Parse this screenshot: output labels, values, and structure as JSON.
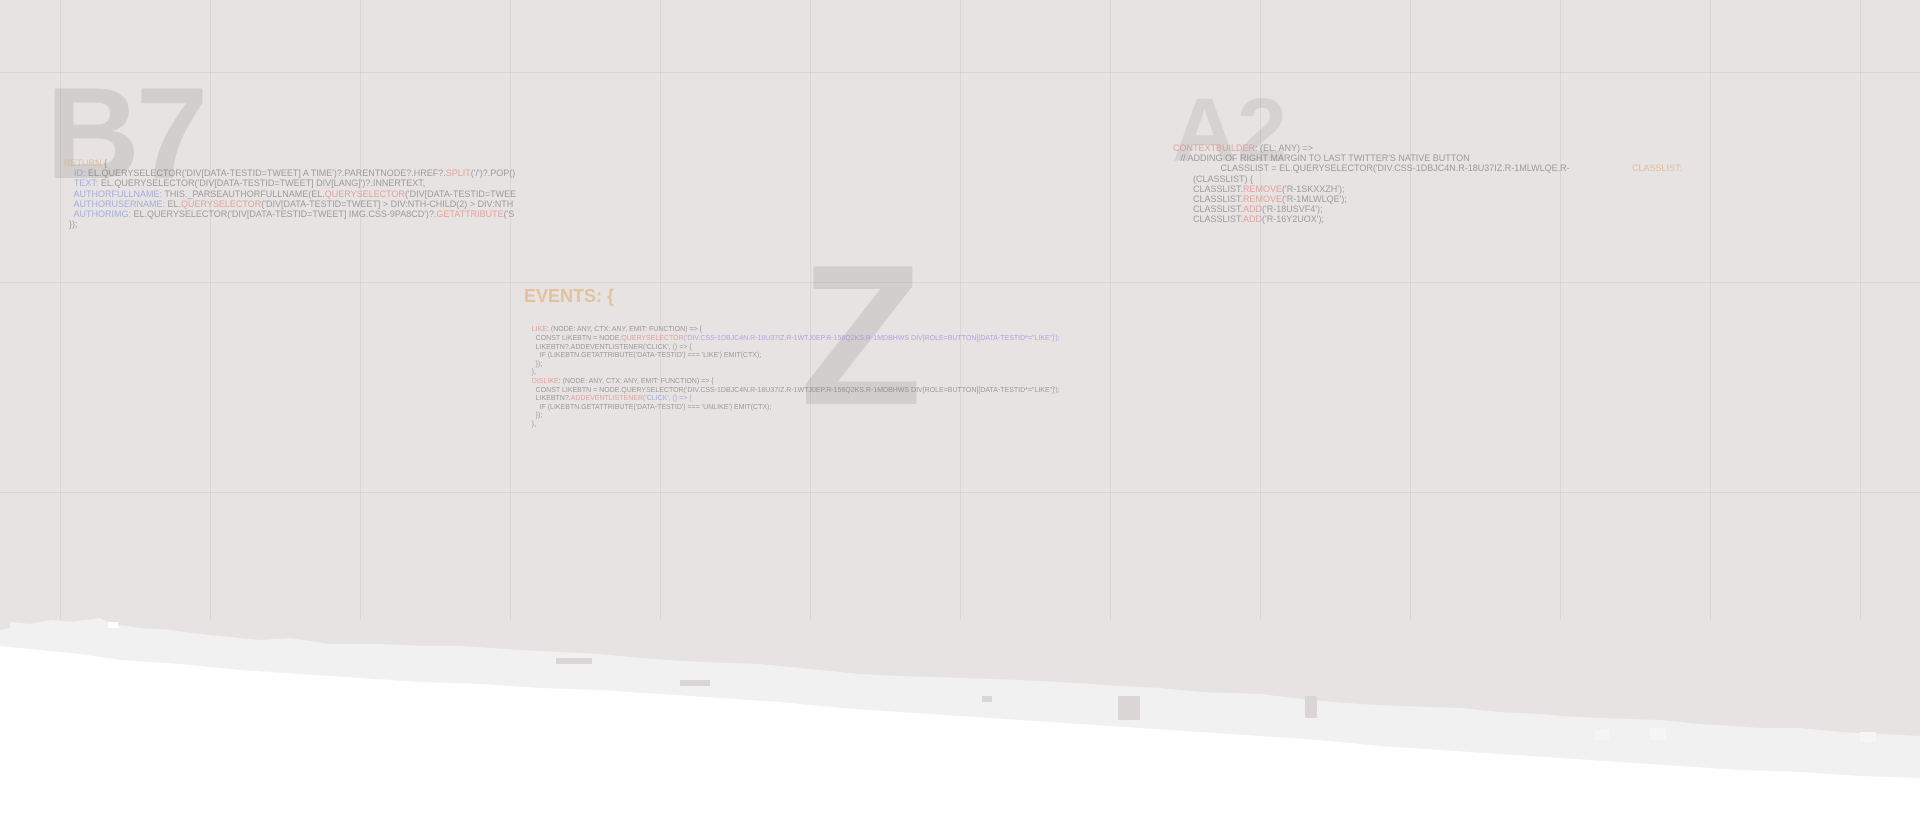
{
  "background": {
    "color": "#e6e3e2",
    "paper_color": "#ffffff"
  },
  "big_letters": {
    "b7": "B7",
    "z": "Z",
    "a2": "A2"
  },
  "code_block_1": {
    "lines": [
      [
        {
          "t": "RETURN ",
          "c": "orange"
        },
        {
          "t": "{",
          "c": ""
        }
      ],
      [
        {
          "t": "    ID: ",
          "c": "blue"
        },
        {
          "t": "EL.QUERYSELECTOR('DIV[DATA-TESTID=TWEET] A TIME')?.PARENTNODE?.HREF?.",
          "c": ""
        },
        {
          "t": "SPLIT",
          "c": "red"
        },
        {
          "t": "('/')?.POP()",
          "c": ""
        }
      ],
      [
        {
          "t": "    TEXT: ",
          "c": "blue"
        },
        {
          "t": "EL.QUERYSELECTOR('DIV[DATA-TESTID=TWEET] DIV[LANG]')?.INNERTEXT,",
          "c": ""
        }
      ],
      [
        {
          "t": "    AUTHORFULLNAME: ",
          "c": "blue"
        },
        {
          "t": "THIS._PARSEAUTHORFULLNAME(EL.",
          "c": ""
        },
        {
          "t": "QUERYSELECTOR",
          "c": "red"
        },
        {
          "t": "('DIV[DATA-TESTID=TWEE",
          "c": ""
        }
      ],
      [
        {
          "t": "    AUTHORUSERNAME: ",
          "c": "blue"
        },
        {
          "t": "EL.",
          "c": ""
        },
        {
          "t": "QUERYSELECTOR",
          "c": "red"
        },
        {
          "t": "('DIV[DATA-TESTID=TWEET] > DIV:NTH-CHILD(2) > DIV:NTH",
          "c": ""
        }
      ],
      [
        {
          "t": "    AUTHORIMG: ",
          "c": "blue"
        },
        {
          "t": "EL.QUERYSELECTOR('DIV[DATA-TESTID=TWEET] IMG.CSS-9PA8CD')?.",
          "c": ""
        },
        {
          "t": "GETATTRIBUTE",
          "c": "red"
        },
        {
          "t": "('S",
          "c": ""
        }
      ],
      [
        {
          "t": "  });",
          "c": ""
        }
      ]
    ]
  },
  "code_block_2": {
    "title": "EVENTS: {",
    "lines": [
      [
        {
          "t": "    LIKE",
          "c": "red"
        },
        {
          "t": ": (NODE: ANY, CTX: ANY, EMIT: FUNCTION) => {",
          "c": ""
        }
      ],
      [
        {
          "t": "      CONST LIKEBTN = NODE.",
          "c": ""
        },
        {
          "t": "QUERYSELECTOR",
          "c": "red"
        },
        {
          "t": "('DIV.CSS-1DBJC4N.R-18U37IZ.R-1WTJ0EP.R-156Q2KS.R-1MDBHWS DIV[ROLE=BUTTON][DATA-TESTID*=\"LIKE\"]');",
          "c": "purple"
        }
      ],
      [
        {
          "t": "      LIKEBTN?.ADDEVENTLISTENER('CLICK', () => {",
          "c": ""
        }
      ],
      [
        {
          "t": "        IF (LIKEBTN.GETATTRIBUTE('DATA-TESTID') === 'LIKE') EMIT(CTX);",
          "c": ""
        }
      ],
      [
        {
          "t": "      });",
          "c": ""
        }
      ],
      [
        {
          "t": "    },",
          "c": ""
        }
      ],
      [
        {
          "t": "    DISLIKE",
          "c": "red"
        },
        {
          "t": ": (NODE: ANY, CTX: ANY, EMIT: FUNCTION) => {",
          "c": ""
        }
      ],
      [
        {
          "t": "      CONST LIKEBTN = NODE.QUERYSELECTOR('DIV.CSS-1DBJC4N.R-18U37IZ.R-1WTJ0EP.R-156Q2KS.R-1MDBHWS DIV[ROLE=BUTTON][DATA-TESTID*=\"LIKE\"]');",
          "c": ""
        }
      ],
      [
        {
          "t": "      LIKEBTN?.",
          "c": ""
        },
        {
          "t": "ADDEVENTLISTENER",
          "c": "red"
        },
        {
          "t": "('CLICK', () => {",
          "c": "blue"
        }
      ],
      [
        {
          "t": "        IF (LIKEBTN.GETATTRIBUTE('DATA-TESTID') === 'UNLIKE') EMIT(CTX);",
          "c": ""
        }
      ],
      [
        {
          "t": "      });",
          "c": ""
        }
      ],
      [
        {
          "t": "    },",
          "c": ""
        }
      ]
    ]
  },
  "code_block_3": {
    "aside": "CLASSLIST:",
    "lines": [
      [
        {
          "t": "CONTEXTBUILDER",
          "c": "red"
        },
        {
          "t": ": (EL: ANY) => ",
          "c": ""
        }
      ],
      [
        {
          "t": "   // ADDING OF RIGHT MARGIN TO LAST TWITTER'S NATIVE BUTTON",
          "c": ""
        }
      ],
      [
        {
          "t": "                   CLASSLIST = EL.QUERYSELECTOR('DIV.CSS-1DBJC4N.R-18U37IZ.R-1MLWLQE.R-",
          "c": ""
        }
      ],
      [
        {
          "t": "        (CLASSLIST) {",
          "c": ""
        }
      ],
      [
        {
          "t": "        CLASSLIST.",
          "c": ""
        },
        {
          "t": "REMOVE",
          "c": "red"
        },
        {
          "t": "('R-1SKXXZH');",
          "c": ""
        }
      ],
      [
        {
          "t": "        CLASSLIST.",
          "c": ""
        },
        {
          "t": "REMOVE",
          "c": "red"
        },
        {
          "t": "('R-1MLWLQE');",
          "c": ""
        }
      ],
      [
        {
          "t": "        CLASSLIST.",
          "c": ""
        },
        {
          "t": "ADD",
          "c": "red"
        },
        {
          "t": "('R-18USVF4');",
          "c": ""
        }
      ],
      [
        {
          "t": "        CLASSLIST.",
          "c": ""
        },
        {
          "t": "ADD",
          "c": "red"
        },
        {
          "t": "('R-16Y2UOX');",
          "c": ""
        }
      ]
    ]
  }
}
